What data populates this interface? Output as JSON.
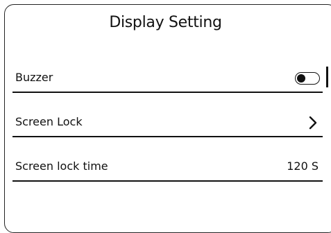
{
  "header": {
    "title": "Display Setting"
  },
  "settings": [
    {
      "label": "Buzzer",
      "control": "toggle",
      "toggle_state": "off"
    },
    {
      "label": "Screen Lock",
      "control": "chevron-right-icon"
    },
    {
      "label": "Screen lock time",
      "value": "120 S"
    }
  ],
  "colors": {
    "foreground": "#111111",
    "background": "#ffffff"
  }
}
